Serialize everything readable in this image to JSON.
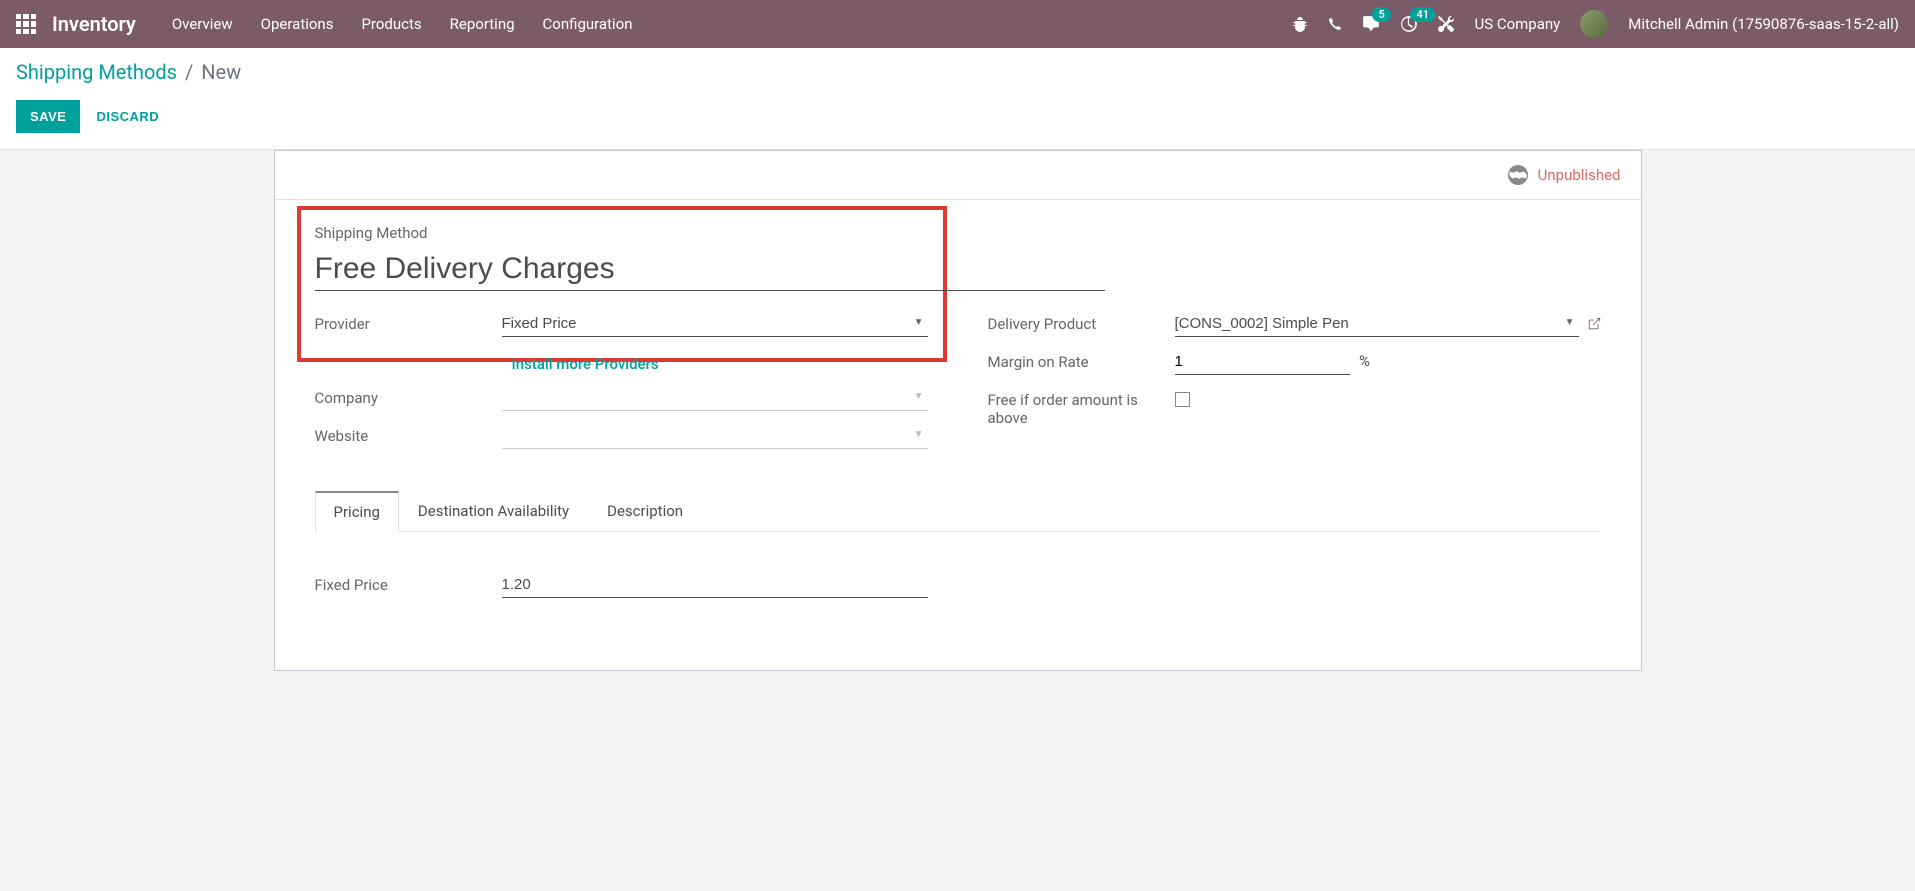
{
  "topbar": {
    "brand": "Inventory",
    "menu": [
      "Overview",
      "Operations",
      "Products",
      "Reporting",
      "Configuration"
    ],
    "messages_badge": "5",
    "activities_badge": "41",
    "company": "US Company",
    "user": "Mitchell Admin (17590876-saas-15-2-all)"
  },
  "breadcrumb": {
    "parent": "Shipping Methods",
    "current": "New"
  },
  "buttons": {
    "save": "SAVE",
    "discard": "DISCARD"
  },
  "status": {
    "unpublished": "Unpublished"
  },
  "form": {
    "shipping_method_label": "Shipping Method",
    "shipping_method_value": "Free Delivery Charges",
    "provider_label": "Provider",
    "provider_value": "Fixed Price",
    "install_providers": "Install more Providers",
    "company_label": "Company",
    "company_value": "",
    "website_label": "Website",
    "website_value": "",
    "delivery_product_label": "Delivery Product",
    "delivery_product_value": "[CONS_0002] Simple Pen",
    "margin_label": "Margin on Rate",
    "margin_value": "1",
    "margin_unit": "%",
    "free_above_label": "Free if order amount is above"
  },
  "tabs": {
    "pricing": "Pricing",
    "destination": "Destination Availability",
    "description": "Description"
  },
  "pricing": {
    "fixed_price_label": "Fixed Price",
    "fixed_price_value": "1.20"
  }
}
